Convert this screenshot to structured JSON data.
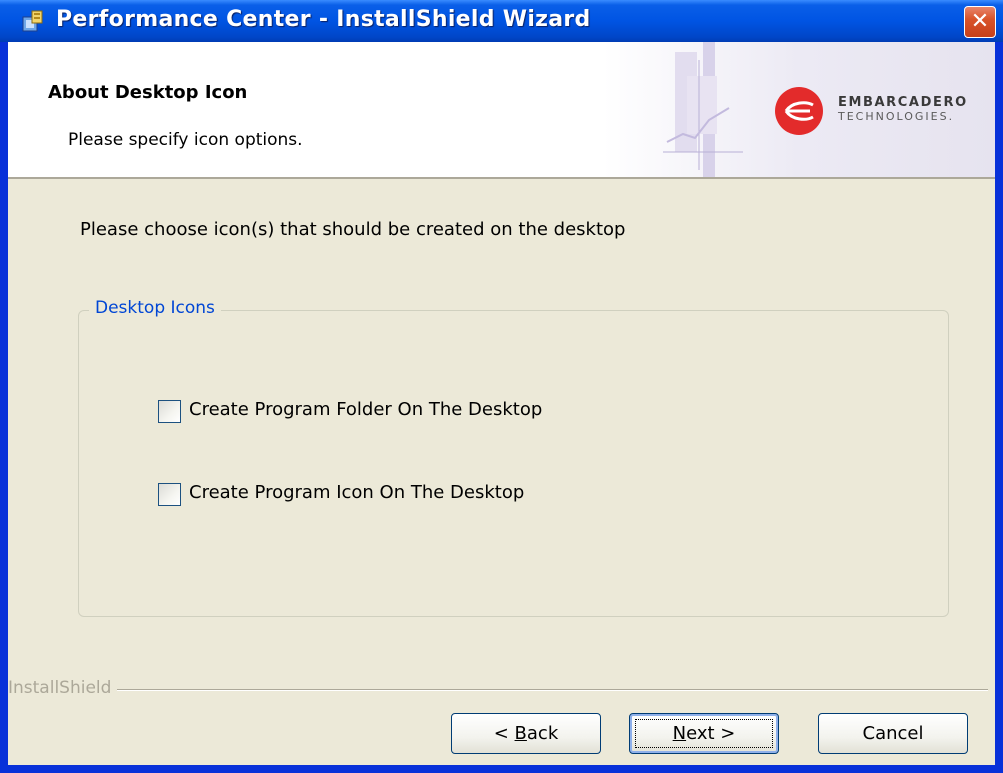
{
  "window": {
    "title": "Performance Center - InstallShield Wizard",
    "close_glyph": "✕"
  },
  "banner": {
    "title": "About Desktop Icon",
    "subtitle": "Please specify icon options.",
    "logo_line1": "EMBARCADERO",
    "logo_line2": "TECHNOLOGIES."
  },
  "main": {
    "instruction": "Please choose icon(s) that should be created on the desktop",
    "group_title": "Desktop Icons",
    "options": [
      {
        "label": "Create Program Folder On The Desktop",
        "checked": false
      },
      {
        "label": "Create Program Icon On The Desktop",
        "checked": false
      }
    ]
  },
  "footer": {
    "brand": "InstallShield",
    "back_prefix": "< ",
    "back_accel": "B",
    "back_rest": "ack",
    "next_accel": "N",
    "next_rest": "ext >",
    "cancel": "Cancel"
  },
  "colors": {
    "titlebar": "#0054e3",
    "dialog_bg": "#ece9d8",
    "group_title": "#0046d5",
    "logo_red": "#e32b2b"
  },
  "icons": [
    "installer-icon",
    "close-icon",
    "embarcadero-logo-icon",
    "checkbox"
  ]
}
